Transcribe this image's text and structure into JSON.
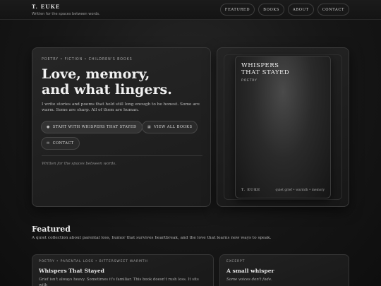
{
  "header": {
    "brand": "T. EUKE",
    "tagline": "Written for the spaces between words.",
    "nav": [
      "FEATURED",
      "BOOKS",
      "ABOUT",
      "CONTACT"
    ]
  },
  "hero": {
    "eyebrow": "POETRY • FICTION • CHILDREN'S BOOKS",
    "title_line1": "Love, memory,",
    "title_line2": "and what lingers.",
    "description": "I write stories and poems that hold still long enough to be honest. Some are warm. Some are sharp. All of them are human.",
    "primary_button": "START WITH  WHISPERS THAT STAYED",
    "books_button": "VIEW ALL BOOKS",
    "contact_button": "CONTACT",
    "footnote": "Written for the spaces between words."
  },
  "book": {
    "title_line1": "WHISPERS",
    "title_line2": "THAT STAYED",
    "genre": "POETRY",
    "author": "T. EUKE",
    "tags": "quiet grief • warmth • memory"
  },
  "featured": {
    "title": "Featured",
    "description": "A quiet collection about parental loss, humor that survives heartbreak, and the love that learns new ways to speak.",
    "card_a": {
      "eyebrow": "POETRY  •  PARENTAL LOSS  •  BITTERSWEET WARMTH",
      "title": "Whispers That Stayed",
      "text": "Grief isn't always heavy. Sometimes it's familiar. This book doesn't rush loss. It sits with"
    },
    "card_b": {
      "eyebrow": "EXCERPT",
      "title": "A small whisper",
      "text": "Some voices don't fade."
    }
  },
  "icons": {
    "primary": "dot-icon",
    "books": "book-icon",
    "contact": "mail-icon"
  }
}
